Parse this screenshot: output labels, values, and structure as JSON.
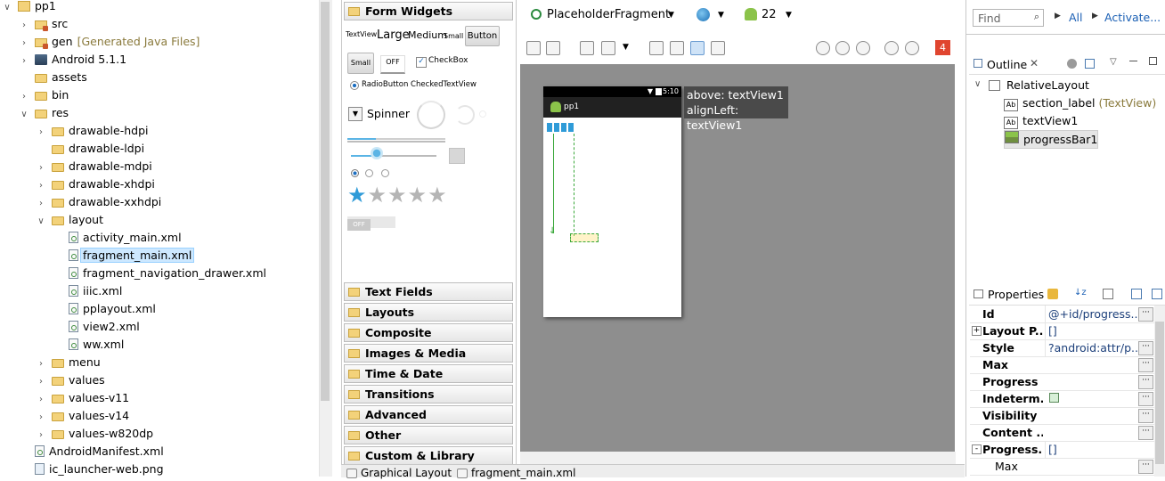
{
  "project_tree": {
    "items": [
      {
        "label": "pp1",
        "indent": 0,
        "toggle": "open",
        "icon": "project"
      },
      {
        "label": "src",
        "indent": 1,
        "toggle": "closed",
        "icon": "package-folder"
      },
      {
        "label": "gen",
        "suffix": "[Generated Java Files]",
        "indent": 1,
        "toggle": "closed",
        "icon": "package-folder"
      },
      {
        "label": "Android 5.1.1",
        "indent": 1,
        "toggle": "closed",
        "icon": "library"
      },
      {
        "label": "assets",
        "indent": 1,
        "toggle": "none",
        "icon": "folder"
      },
      {
        "label": "bin",
        "indent": 1,
        "toggle": "closed",
        "icon": "folder"
      },
      {
        "label": "res",
        "indent": 1,
        "toggle": "open",
        "icon": "folder"
      },
      {
        "label": "drawable-hdpi",
        "indent": 2,
        "toggle": "closed",
        "icon": "folder"
      },
      {
        "label": "drawable-ldpi",
        "indent": 2,
        "toggle": "none",
        "icon": "folder"
      },
      {
        "label": "drawable-mdpi",
        "indent": 2,
        "toggle": "closed",
        "icon": "folder"
      },
      {
        "label": "drawable-xhdpi",
        "indent": 2,
        "toggle": "closed",
        "icon": "folder"
      },
      {
        "label": "drawable-xxhdpi",
        "indent": 2,
        "toggle": "closed",
        "icon": "folder"
      },
      {
        "label": "layout",
        "indent": 2,
        "toggle": "open",
        "icon": "folder"
      },
      {
        "label": "activity_main.xml",
        "indent": 3,
        "toggle": "none",
        "icon": "xml-file"
      },
      {
        "label": "fragment_main.xml",
        "indent": 3,
        "toggle": "none",
        "icon": "xml-file",
        "selected": true
      },
      {
        "label": "fragment_navigation_drawer.xml",
        "indent": 3,
        "toggle": "none",
        "icon": "xml-file"
      },
      {
        "label": "iiic.xml",
        "indent": 3,
        "toggle": "none",
        "icon": "xml-file"
      },
      {
        "label": "pplayout.xml",
        "indent": 3,
        "toggle": "none",
        "icon": "xml-file"
      },
      {
        "label": "view2.xml",
        "indent": 3,
        "toggle": "none",
        "icon": "xml-file"
      },
      {
        "label": "ww.xml",
        "indent": 3,
        "toggle": "none",
        "icon": "xml-file"
      },
      {
        "label": "menu",
        "indent": 2,
        "toggle": "closed",
        "icon": "folder"
      },
      {
        "label": "values",
        "indent": 2,
        "toggle": "closed",
        "icon": "folder"
      },
      {
        "label": "values-v11",
        "indent": 2,
        "toggle": "closed",
        "icon": "folder"
      },
      {
        "label": "values-v14",
        "indent": 2,
        "toggle": "closed",
        "icon": "folder"
      },
      {
        "label": "values-w820dp",
        "indent": 2,
        "toggle": "closed",
        "icon": "folder"
      },
      {
        "label": "AndroidManifest.xml",
        "indent": 1,
        "toggle": "none",
        "icon": "xml-file"
      },
      {
        "label": "ic_launcher-web.png",
        "indent": 1,
        "toggle": "none",
        "icon": "png-file"
      }
    ]
  },
  "palette": {
    "form_widgets_header": "Form Widgets",
    "textview_small": "TextView",
    "textview_large": "Large",
    "textview_medium": "Medium",
    "textview_smallest": "Small",
    "button_label": "Button",
    "small_button": "Small",
    "toggle_off": "OFF",
    "checkbox_label": "CheckBox",
    "radio_checked_label": "RadioButton CheckedTextView",
    "spinner_label": "Spinner",
    "switch_off": "OFF",
    "rating_stars_filled": 1,
    "rating_stars_total": 5,
    "categories": [
      "Text Fields",
      "Layouts",
      "Composite",
      "Images & Media",
      "Time & Date",
      "Transitions",
      "Advanced",
      "Other",
      "Custom & Library Views"
    ]
  },
  "editor_toolbar": {
    "fragment_selector": "PlaceholderFragment",
    "api_level": "22",
    "error_count": "4"
  },
  "device": {
    "status_time": "5:10",
    "app_title": "pp1"
  },
  "tooltip": {
    "line1": "above: textView1",
    "line2": "alignLeft: textView1"
  },
  "find_bar": {
    "placeholder": "Find",
    "all_label": "All",
    "activate_label": "Activate..."
  },
  "outline": {
    "title": "Outline",
    "root": "RelativeLayout",
    "children": [
      {
        "label": "section_label",
        "suffix": "(TextView)",
        "icon": "textview"
      },
      {
        "label": "textView1",
        "suffix": "",
        "icon": "textview"
      },
      {
        "label": "progressBar1",
        "suffix": "",
        "icon": "progressbar",
        "selected": true
      }
    ]
  },
  "properties": {
    "title": "Properties",
    "rows": [
      {
        "key": "Id",
        "value": "@+id/progress...",
        "button": true,
        "expand": ""
      },
      {
        "key": "Layout P...",
        "value": "[]",
        "button": false,
        "expand": "+"
      },
      {
        "key": "Style",
        "value": "?android:attr/p...",
        "button": true,
        "expand": ""
      },
      {
        "key": "Max",
        "value": "",
        "button": true,
        "expand": ""
      },
      {
        "key": "Progress",
        "value": "",
        "button": true,
        "expand": ""
      },
      {
        "key": "Indeterm...",
        "value": "",
        "button": true,
        "expand": "",
        "checkbox": true
      },
      {
        "key": "Visibility",
        "value": "",
        "button": true,
        "expand": ""
      },
      {
        "key": "Content ...",
        "value": "",
        "button": true,
        "expand": ""
      },
      {
        "key": "Progress...",
        "value": "[]",
        "button": false,
        "expand": "-"
      },
      {
        "key": "Max",
        "value": "",
        "button": true,
        "expand": "",
        "sub": true
      }
    ]
  },
  "bottom_tabs": [
    "Graphical Layout",
    "fragment_main.xml"
  ]
}
